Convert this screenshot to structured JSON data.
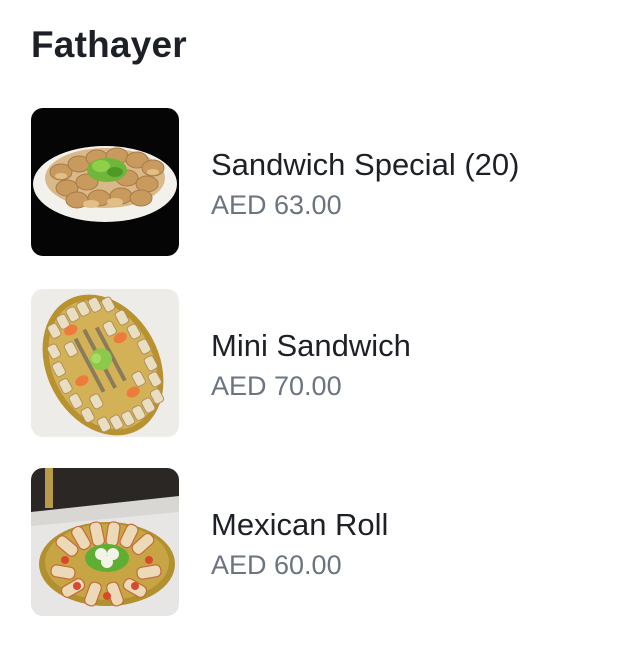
{
  "section": {
    "title": "Fathayer"
  },
  "items": [
    {
      "name": "Sandwich Special (20)",
      "price": "AED 63.00",
      "image": "platter-of-baked-sandwiches-on-black"
    },
    {
      "name": "Mini Sandwich",
      "price": "AED 70.00",
      "image": "oval-tray-of-mini-sandwiches"
    },
    {
      "name": "Mexican Roll",
      "price": "AED 60.00",
      "image": "round-tray-of-mexican-rolls"
    }
  ],
  "colors": {
    "title": "#1d2127",
    "name": "#1d2127",
    "price": "#6b7480",
    "background": "#ffffff"
  }
}
